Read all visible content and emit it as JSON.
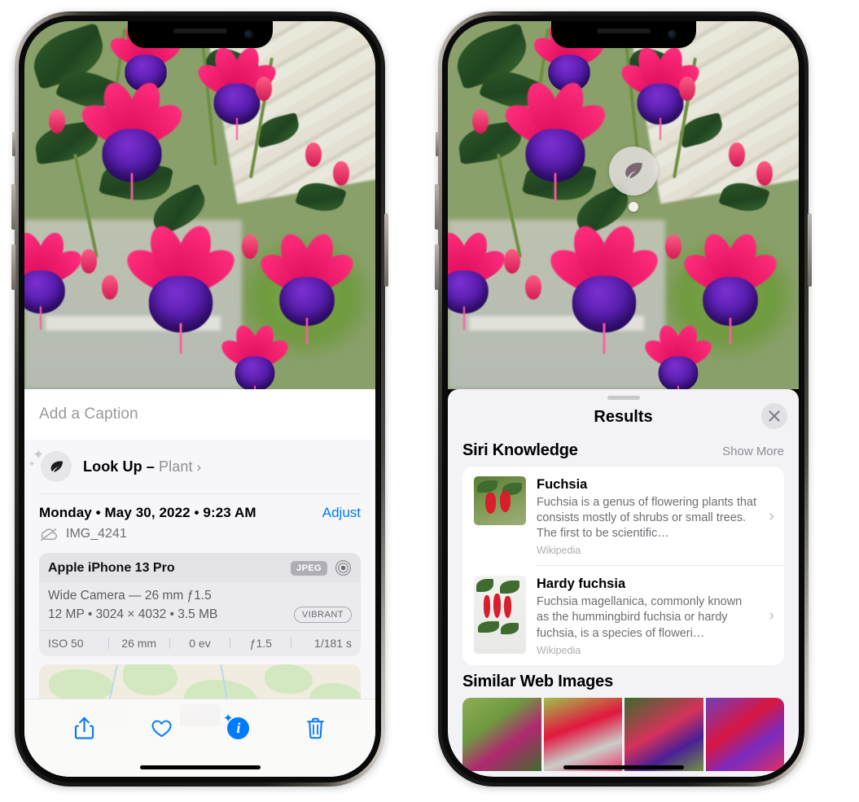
{
  "left_phone": {
    "caption": {
      "placeholder": "Add a Caption",
      "value": ""
    },
    "look_up": {
      "label": "Look Up – ",
      "subject": "Plant",
      "chevron": "›",
      "icon": "leaf-icon"
    },
    "date": {
      "text": "Monday • May 30, 2022 • 9:23 AM",
      "adjust_label": "Adjust"
    },
    "file": {
      "name": "IMG_4241",
      "icon": "icloud-off-icon"
    },
    "camera": {
      "device": "Apple iPhone 13 Pro",
      "format_chip": "JPEG",
      "raw_icon": "raw-circle-icon",
      "lens_line": "Wide Camera — 26 mm ƒ1.5",
      "spec_line": "12 MP • 3024 × 4032 • 3.5 MB",
      "style_chip": "VIBRANT",
      "exif": [
        "ISO 50",
        "26 mm",
        "0 ev",
        "ƒ1.5",
        "1/181 s"
      ]
    },
    "toolbar": [
      {
        "name": "share-button",
        "icon": "share-icon"
      },
      {
        "name": "favorite-button",
        "icon": "heart-icon"
      },
      {
        "name": "info-button",
        "icon": "info-sparkle-icon"
      },
      {
        "name": "delete-button",
        "icon": "trash-icon"
      }
    ]
  },
  "right_phone": {
    "badge": {
      "icon": "leaf-icon"
    },
    "panel": {
      "title": "Results",
      "close_icon": "close-icon",
      "sections": [
        {
          "title": "Siri Knowledge",
          "action": "Show More"
        },
        {
          "title": "Similar Web Images",
          "action": ""
        }
      ],
      "knowledge": [
        {
          "title": "Fuchsia",
          "description": "Fuchsia is a genus of flowering plants that consists mostly of shrubs or small trees. The first to be scientific…",
          "source": "Wikipedia",
          "chevron": "›"
        },
        {
          "title": "Hardy fuchsia",
          "description": "Fuchsia magellanica, commonly known as the hummingbird fuchsia or hardy fuchsia, is a species of floweri…",
          "source": "Wikipedia",
          "chevron": "›"
        }
      ],
      "similar_images_count": 4
    }
  },
  "colors": {
    "accent_blue": "#007aff",
    "panel_bg": "#f2f2f7",
    "card_bg": "#ffffff",
    "secondary_text": "#8e8e93",
    "info_bg": "#f7f7f9"
  }
}
